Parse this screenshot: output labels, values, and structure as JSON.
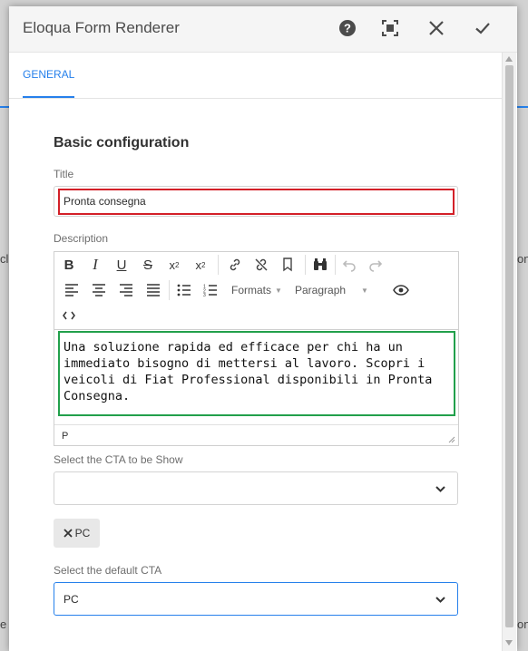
{
  "dialog": {
    "title": "Eloqua Form Renderer",
    "icons": [
      "help-icon",
      "fullscreen-icon",
      "close-icon",
      "check-icon"
    ]
  },
  "tabs": [
    {
      "label": "GENERAL",
      "active": true
    }
  ],
  "section": {
    "title": "Basic configuration"
  },
  "fields": {
    "title_label": "Title",
    "title_value": "Pronta consegna",
    "description_label": "Description",
    "description_text": "Una soluzione rapida ed efficace per chi ha un immediato bisogno di mettersi al lavoro. Scopri i veicoli di Fiat Professional disponibili in Pronta Consegna.",
    "editor_path": "P",
    "cta_show_label": "Select the CTA to be Show",
    "cta_show_value": "",
    "cta_tag": "PC",
    "cta_default_label": "Select the default CTA",
    "cta_default_value": "PC"
  },
  "editor_toolbar": {
    "formats_label": "Formats",
    "paragraph_label": "Paragraph"
  },
  "colors": {
    "accent": "#2680eb",
    "title_highlight": "#d32028",
    "description_highlight": "#22a04b"
  }
}
